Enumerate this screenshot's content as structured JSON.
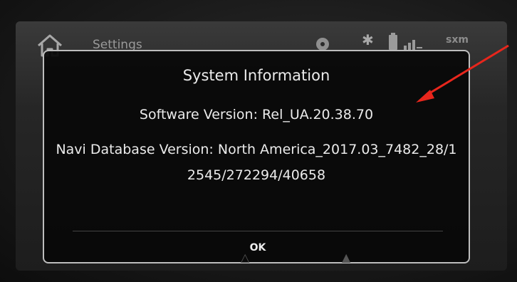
{
  "header": {
    "home_icon": "home-icon",
    "title": "Settings",
    "status_icons": [
      "disc-icon",
      "bluetooth-icon",
      "battery-icon",
      "signal-icon"
    ],
    "sxm_label": "sxm"
  },
  "dialog": {
    "title": "System Information",
    "software_version": "Software Version: Rel_UA.20.38.70",
    "navi_database_version": "Navi Database Version: North America_2017.03_7482_28/12545/272294/40658",
    "ok_label": "OK"
  },
  "colors": {
    "arrow": "#e8261c",
    "dialog_border": "#bdbdbd",
    "text": "#ebebeb"
  }
}
